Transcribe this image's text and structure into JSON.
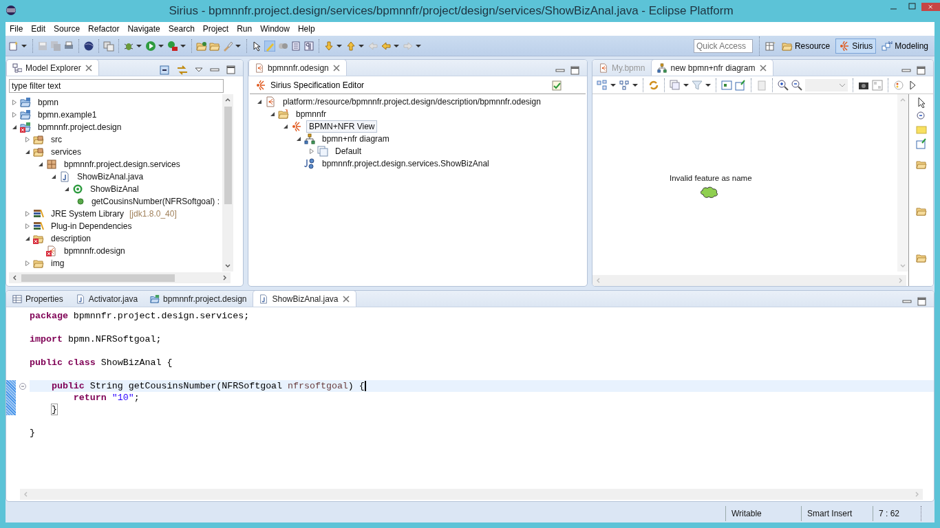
{
  "window": {
    "title": "Sirius - bpmnnfr.project.design/services/bpmnnfr/project/design/services/ShowBizAnal.java - Eclipse Platform"
  },
  "menu": [
    "File",
    "Edit",
    "Source",
    "Refactor",
    "Navigate",
    "Search",
    "Project",
    "Run",
    "Window",
    "Help"
  ],
  "quick_access": {
    "placeholder": "Quick Access"
  },
  "perspectives": [
    {
      "label": "Resource",
      "selected": false
    },
    {
      "label": "Sirius",
      "selected": true
    },
    {
      "label": "Modeling",
      "selected": false
    }
  ],
  "model_explorer": {
    "tabs": [
      {
        "label": "Model Explorer",
        "selected": true
      }
    ],
    "filter": {
      "value": "type filter text"
    },
    "tree": [
      {
        "label": "bpmn",
        "kind": "project",
        "expanded": false,
        "selected": false
      },
      {
        "label": "bpmn.example1",
        "kind": "project",
        "expanded": false,
        "selected": false
      },
      {
        "label": "bpmnnfr.project.design",
        "kind": "plugin",
        "error": true,
        "expanded": true,
        "selected": false,
        "children": [
          {
            "label": "src",
            "kind": "source",
            "expanded": false,
            "selected": false
          },
          {
            "label": "services",
            "kind": "source",
            "expanded": true,
            "selected": false,
            "children": [
              {
                "label": "bpmnnfr.project.design.services",
                "kind": "package",
                "expanded": true,
                "selected": false,
                "children": [
                  {
                    "label": "ShowBizAnal.java",
                    "kind": "java",
                    "expanded": true,
                    "selected": false,
                    "children": [
                      {
                        "label": "ShowBizAnal",
                        "kind": "class",
                        "expanded": true,
                        "selected": false,
                        "children": [
                          {
                            "label": "getCousinsNumber(NFRSoftgoal) :",
                            "kind": "method",
                            "selected": false
                          }
                        ]
                      }
                    ]
                  }
                ]
              }
            ]
          },
          {
            "label": "JRE System Library",
            "decoration": "[jdk1.8.0_40]",
            "kind": "library",
            "expanded": false,
            "selected": false
          },
          {
            "label": "Plug-in Dependencies",
            "kind": "library",
            "expanded": false,
            "selected": false
          },
          {
            "label": "description",
            "kind": "folder",
            "error": true,
            "expanded": true,
            "selected": false,
            "children": [
              {
                "label": "bpmnnfr.odesign",
                "kind": "odesign",
                "error": true,
                "selected": false
              }
            ]
          },
          {
            "label": "img",
            "kind": "folder",
            "expanded": false,
            "selected": false
          }
        ]
      }
    ]
  },
  "odesign_editor": {
    "tabs": [
      {
        "label": "bpmnnfr.odesign",
        "selected": true
      }
    ],
    "header": "Sirius Specification Editor",
    "tree": [
      {
        "label": "platform:/resource/bpmnnfr.project.design/description/bpmnnfr.odesign",
        "kind": "odesign",
        "expanded": true,
        "selected": false,
        "children": [
          {
            "label": "bpmnnfr",
            "kind": "group",
            "expanded": true,
            "selected": false,
            "children": [
              {
                "label": "BPMN+NFR View",
                "kind": "viewpoint",
                "expanded": true,
                "selected": true,
                "children": [
                  {
                    "label": "bpmn+nfr diagram",
                    "kind": "diagram",
                    "expanded": true,
                    "selected": false,
                    "children": [
                      {
                        "label": "Default",
                        "kind": "layer",
                        "expanded": false,
                        "selected": false
                      }
                    ]
                  },
                  {
                    "label": "bpmnnfr.project.design.services.ShowBizAnal",
                    "kind": "service",
                    "selected": false
                  }
                ]
              }
            ]
          }
        ]
      }
    ]
  },
  "diagram_editor": {
    "tabs": [
      {
        "label": "My.bpmn",
        "selected": false
      },
      {
        "label": "new bpmn+nfr diagram",
        "selected": true
      }
    ],
    "nodes": [
      {
        "label": "Invalid feature as name",
        "kind": "cloud"
      }
    ]
  },
  "code_editor": {
    "tabs": [
      {
        "label": "Properties",
        "kind": "properties",
        "selected": false
      },
      {
        "label": "Activator.java",
        "kind": "java",
        "selected": false
      },
      {
        "label": "bpmnnfr.project.design",
        "kind": "plugin",
        "selected": false
      },
      {
        "label": "ShowBizAnal.java",
        "kind": "java",
        "selected": true
      }
    ],
    "lines": [
      {
        "kind": "code",
        "tokens": [
          {
            "kind": "keyword",
            "text": "package"
          },
          {
            "kind": "plain",
            "text": " bpmnnfr.project.design.services;"
          }
        ]
      },
      {
        "kind": "blank"
      },
      {
        "kind": "code",
        "tokens": [
          {
            "kind": "keyword",
            "text": "import"
          },
          {
            "kind": "plain",
            "text": " bpmn.NFRSoftgoal;"
          }
        ]
      },
      {
        "kind": "blank"
      },
      {
        "kind": "code",
        "tokens": [
          {
            "kind": "keyword",
            "text": "public class"
          },
          {
            "kind": "plain",
            "text": " ShowBizAnal {"
          }
        ]
      },
      {
        "kind": "blank"
      },
      {
        "kind": "code",
        "current": true,
        "foldable": true,
        "changed": true,
        "tokens": [
          {
            "kind": "keyword",
            "text": "    public"
          },
          {
            "kind": "plain",
            "text": " String getCousinsNumber(NFRSoftgoal "
          },
          {
            "kind": "param",
            "text": "nfrsoftgoal"
          },
          {
            "kind": "plain",
            "text": ") {"
          }
        ]
      },
      {
        "kind": "code",
        "changed": true,
        "tokens": [
          {
            "kind": "keyword",
            "text": "        return"
          },
          {
            "kind": "string",
            "text": " \"10\""
          },
          {
            "kind": "plain",
            "text": ";"
          }
        ]
      },
      {
        "kind": "code",
        "changed": true,
        "tokens": [
          {
            "kind": "bracket",
            "text": "    }"
          }
        ]
      },
      {
        "kind": "blank"
      },
      {
        "kind": "code",
        "tokens": [
          {
            "kind": "plain",
            "text": "}"
          }
        ]
      }
    ]
  },
  "status_bar": [
    "Writable",
    "Smart Insert",
    "7 : 62"
  ]
}
